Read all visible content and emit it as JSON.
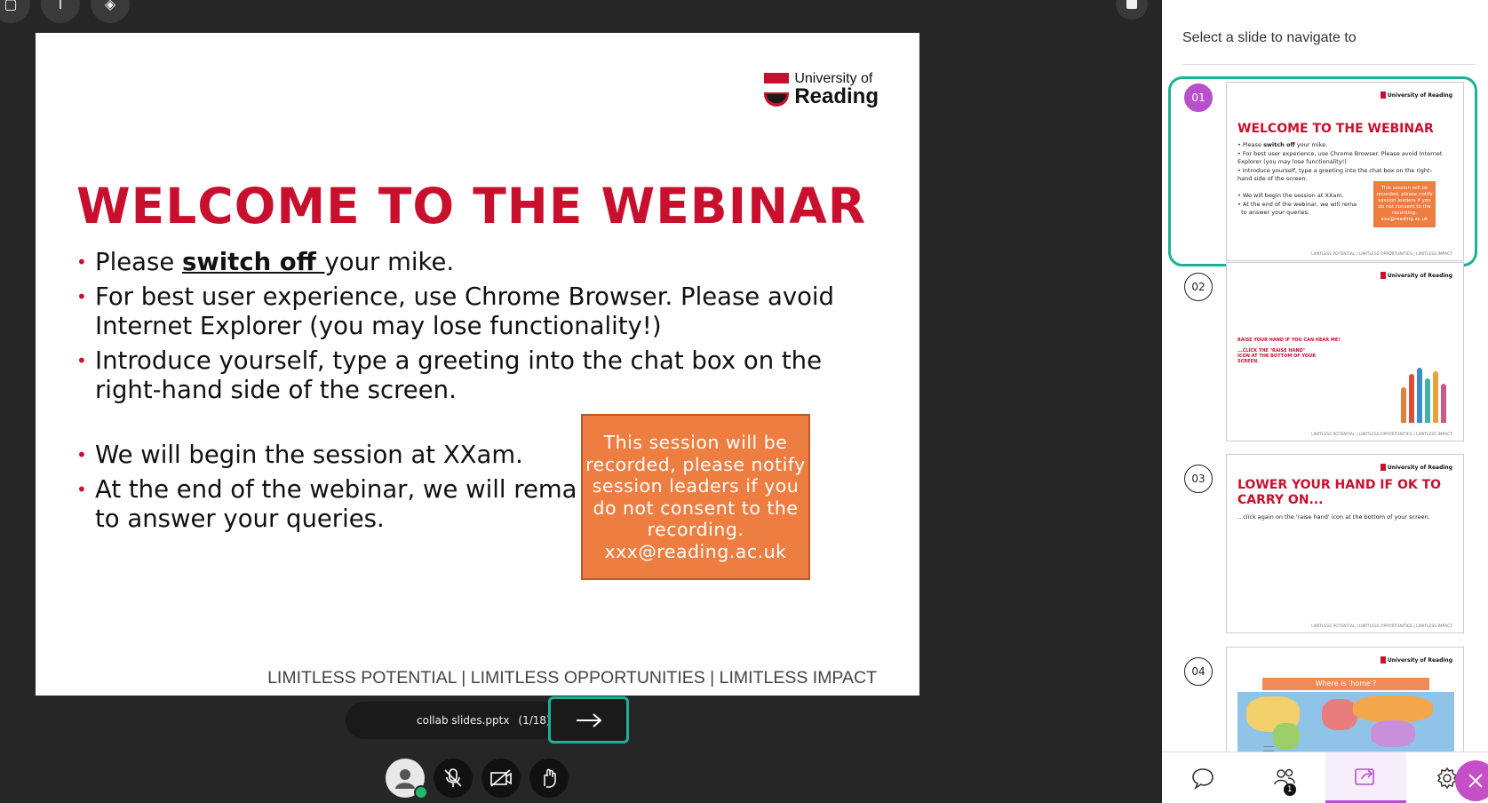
{
  "slide": {
    "logo_line1": "University of",
    "logo_line2": "Reading",
    "title": "WELCOME TO THE WEBINAR",
    "bullet1_pre": "Please ",
    "bullet1_bold": "switch off ",
    "bullet1_post": " your mike.",
    "bullet2": "For best user experience, use Chrome Browser. Please avoid Internet Explorer (you may lose functionality!)",
    "bullet3": "Introduce yourself, type a greeting into the chat box on the right-hand side of the screen.",
    "bullet4": "We will begin the session at XXam.",
    "bullet5": "At the end of the webinar, we will rema",
    "bullet5_line2": "to answer your queries.",
    "box_text": "This session will be recorded, please notify session leaders if you do not consent to the recording. xxx@reading.ac.uk",
    "footer": "LIMITLESS POTENTIAL  |  LIMITLESS OPPORTUNITIES  |  LIMITLESS IMPACT"
  },
  "nav": {
    "file_name": "collab slides.pptx",
    "count": "(1/18)"
  },
  "panel": {
    "header": "Select a slide to navigate to",
    "slides": [
      {
        "number": "01",
        "title": "WELCOME TO THE WEBINAR"
      },
      {
        "number": "02",
        "title": "RAISE YOUR HAND IF YOU CAN HEAR ME!",
        "body": "...CLICK THE \"RAISE HAND\" ICON AT THE BOTTOM OF YOUR SCREEN."
      },
      {
        "number": "03",
        "title": "LOWER YOUR HAND IF OK TO CARRY ON...",
        "body": "...click again on the 'raise hand' icon at the bottom of your screen."
      },
      {
        "number": "04",
        "title": "Where is 'home'?"
      }
    ],
    "thumb_logo": "University of Reading",
    "thumb_footer": "LIMITLESS POTENTIAL | LIMITLESS OPPORTUNITIES | LIMITLESS IMPACT",
    "participants_badge": "1"
  },
  "colors": {
    "accent": "#1bb195",
    "brand_red": "#c8102e",
    "orange": "#ed7d40",
    "purple": "#b84fcb"
  }
}
